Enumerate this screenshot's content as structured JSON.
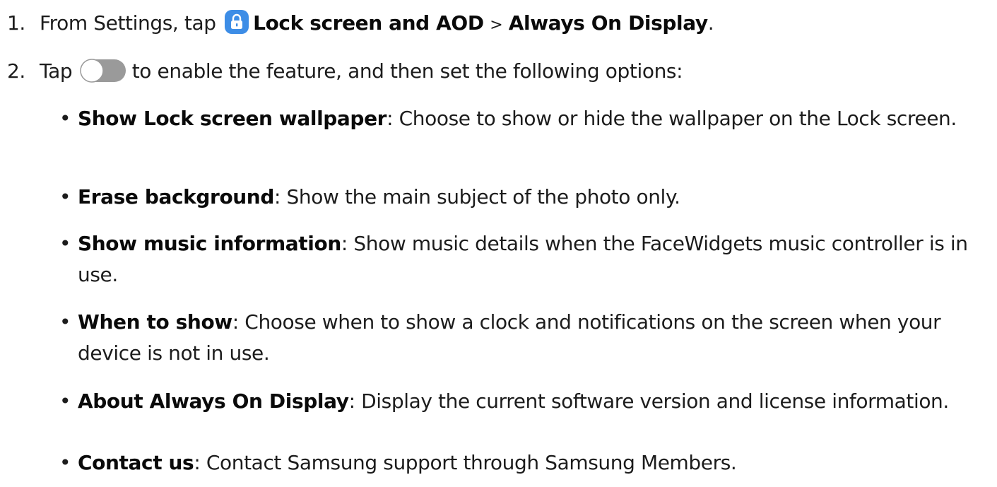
{
  "steps": [
    {
      "number": "1.",
      "prefix": "From Settings, tap",
      "icon": "lock-settings-icon",
      "path_first": "Lock screen and AOD",
      "separator": ">",
      "path_second": "Always On Display",
      "suffix": "."
    },
    {
      "number": "2.",
      "prefix": "Tap",
      "icon": "toggle-switch-icon",
      "suffix": "to enable the feature, and then set the following options:"
    }
  ],
  "options": [
    {
      "term": "Show Lock screen wallpaper",
      "description": ": Choose to show or hide the wallpaper on the Lock screen."
    },
    {
      "term": "Erase background",
      "description": ": Show the main subject of the photo only."
    },
    {
      "term": "Show music information",
      "description": ": Show music details when the FaceWidgets music controller is in use."
    },
    {
      "term": "When to show",
      "description": ": Choose when to show a clock and notifications on the screen when your device is not in use."
    },
    {
      "term": "About Always On Display",
      "description": ": Display the current software version and license information."
    },
    {
      "term": "Contact us",
      "description": ": Contact Samsung support through Samsung Members."
    }
  ],
  "colors": {
    "text": "#1c1c1c",
    "icon_blue": "#3d8de6",
    "toggle_knob": "#9a9a9a"
  }
}
